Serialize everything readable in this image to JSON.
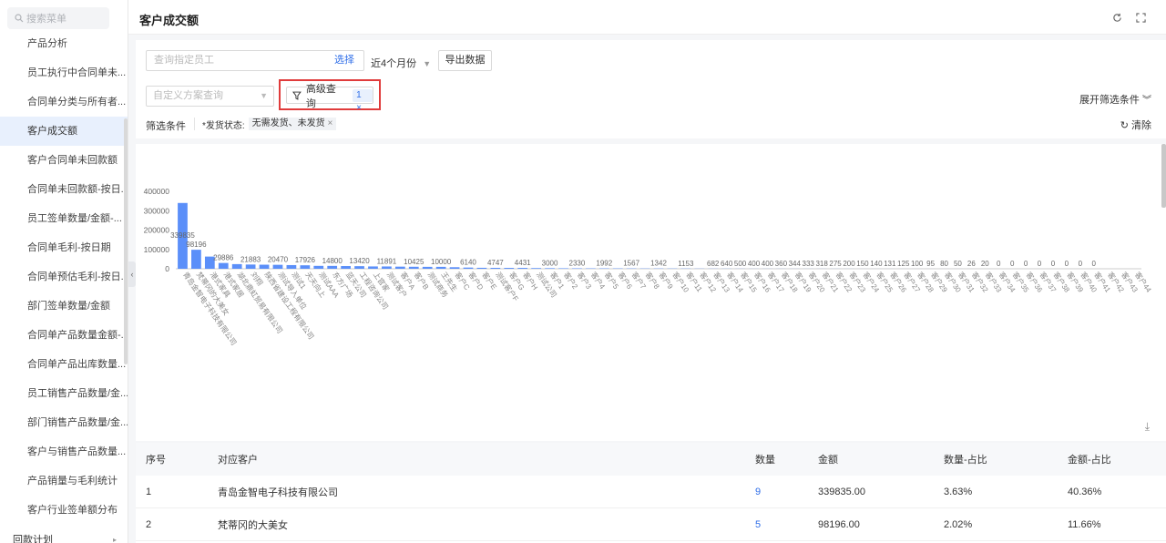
{
  "sidebar": {
    "search_placeholder": "搜索菜单",
    "items": [
      {
        "label": "产品分析"
      },
      {
        "label": "员工执行中合同单未..."
      },
      {
        "label": "合同单分类与所有者..."
      },
      {
        "label": "客户成交额"
      },
      {
        "label": "客户合同单未回款额"
      },
      {
        "label": "合同单未回款额-按日..."
      },
      {
        "label": "员工签单数量/金额-..."
      },
      {
        "label": "合同单毛利-按日期"
      },
      {
        "label": "合同单预估毛利-按日..."
      },
      {
        "label": "部门签单数量/金额"
      },
      {
        "label": "合同单产品数量金额-..."
      },
      {
        "label": "合同单产品出库数量..."
      },
      {
        "label": "员工销售产品数量/金..."
      },
      {
        "label": "部门销售产品数量/金..."
      },
      {
        "label": "客户与销售产品数量..."
      },
      {
        "label": "产品销量与毛利统计"
      },
      {
        "label": "客户行业签单额分布"
      }
    ],
    "group_label": "回款计划",
    "active_index": 3
  },
  "header": {
    "title": "客户成交额"
  },
  "filters": {
    "employee_placeholder": "查询指定员工",
    "employee_select": "选择",
    "period": "近4个月份",
    "export": "导出数据",
    "scheme_placeholder": "自定义方案查询",
    "advanced": "高级查询",
    "advanced_count": "1",
    "expand": "展开筛选条件",
    "condition_label": "筛选条件",
    "condition_key": "*发货状态:",
    "condition_value": "无需发货、未发货",
    "clear": "清除"
  },
  "chart_data": {
    "type": "bar",
    "color": "#5b8ff9",
    "ylim": [
      0,
      400000
    ],
    "yticks": [
      0,
      100000,
      200000,
      300000,
      400000
    ],
    "categories": [
      "青岛金智电子科技有限公司",
      "梵蒂冈的大美女",
      "港式家具",
      "港式家居",
      "湖北鼎虹贸易有限公司",
      "刘翔",
      "陕西省建设工程有限公司",
      "测试导入单位",
      "测试1",
      "天天向上",
      "测试AAA",
      "东方广场",
      "蓝天公司",
      "工程咨询公司",
      "上官家",
      "测试客户",
      "客户A",
      "客户B",
      "测试商务",
      "王先生",
      "客户C",
      "客户D",
      "客户E",
      "测试客户F",
      "客户G",
      "客户H",
      "测试公司",
      "客户1",
      "客户2",
      "客户3",
      "客户4",
      "客户5",
      "客户6",
      "客户7",
      "客户8",
      "客户9",
      "客户10",
      "客户11",
      "客户12",
      "客户13",
      "客户14",
      "客户15",
      "客户16",
      "客户17",
      "客户18",
      "客户19",
      "客户20",
      "客户21",
      "客户22",
      "客户23",
      "客户24",
      "客户25",
      "客户26",
      "客户27",
      "客户28",
      "客户29",
      "客户30",
      "客户31",
      "客户32",
      "客户33",
      "客户34",
      "客户35",
      "客户36",
      "客户37",
      "客户38",
      "客户39",
      "客户40",
      "客户41",
      "客户42",
      "客户43",
      "客户44"
    ],
    "values": [
      339835,
      98196,
      63000,
      29886,
      24000,
      21883,
      21000,
      20470,
      19000,
      17926,
      15000,
      14800,
      14000,
      13420,
      12000,
      11891,
      11000,
      10425,
      10000,
      10000,
      8000,
      6140,
      5000,
      4747,
      4500,
      4431,
      3500,
      3000,
      2500,
      2330,
      2000,
      1992,
      1800,
      1567,
      1400,
      1342,
      1200,
      1153,
      900,
      682,
      640,
      500,
      400,
      400,
      360,
      344,
      333,
      318,
      275,
      200,
      150,
      140,
      131,
      125,
      100,
      95,
      80,
      50,
      26,
      20,
      0,
      0,
      0,
      0,
      0,
      0,
      0,
      0,
      0,
      0,
      0
    ],
    "labels": [
      {
        "i": 0,
        "text": "339835"
      },
      {
        "i": 1,
        "text": "98196"
      },
      {
        "i": 3,
        "text": "29886"
      },
      {
        "i": 5,
        "text": "21883"
      },
      {
        "i": 7,
        "text": "20470"
      },
      {
        "i": 9,
        "text": "17926"
      },
      {
        "i": 11,
        "text": "14800"
      },
      {
        "i": 13,
        "text": "13420"
      },
      {
        "i": 15,
        "text": "11891"
      },
      {
        "i": 17,
        "text": "10425"
      },
      {
        "i": 19,
        "text": "10000"
      },
      {
        "i": 21,
        "text": "6140"
      },
      {
        "i": 23,
        "text": "4747"
      },
      {
        "i": 25,
        "text": "4431"
      },
      {
        "i": 27,
        "text": "3000"
      },
      {
        "i": 29,
        "text": "2330"
      },
      {
        "i": 31,
        "text": "1992"
      },
      {
        "i": 33,
        "text": "1567"
      },
      {
        "i": 35,
        "text": "1342"
      },
      {
        "i": 37,
        "text": "1153"
      },
      {
        "i": 39,
        "text": "682"
      },
      {
        "i": 40,
        "text": "640"
      },
      {
        "i": 41,
        "text": "500"
      },
      {
        "i": 42,
        "text": "400"
      },
      {
        "i": 43,
        "text": "400"
      },
      {
        "i": 44,
        "text": "360"
      },
      {
        "i": 45,
        "text": "344"
      },
      {
        "i": 46,
        "text": "333"
      },
      {
        "i": 47,
        "text": "318"
      },
      {
        "i": 48,
        "text": "275"
      },
      {
        "i": 49,
        "text": "200"
      },
      {
        "i": 50,
        "text": "150"
      },
      {
        "i": 51,
        "text": "140"
      },
      {
        "i": 52,
        "text": "131"
      },
      {
        "i": 53,
        "text": "125"
      },
      {
        "i": 54,
        "text": "100"
      },
      {
        "i": 55,
        "text": "95"
      },
      {
        "i": 56,
        "text": "80"
      },
      {
        "i": 57,
        "text": "50"
      },
      {
        "i": 58,
        "text": "26"
      },
      {
        "i": 59,
        "text": "20"
      },
      {
        "i": 60,
        "text": "0"
      },
      {
        "i": 61,
        "text": "0"
      },
      {
        "i": 62,
        "text": "0"
      },
      {
        "i": 63,
        "text": "0"
      },
      {
        "i": 64,
        "text": "0"
      },
      {
        "i": 65,
        "text": "0"
      },
      {
        "i": 66,
        "text": "0"
      },
      {
        "i": 67,
        "text": "0"
      }
    ]
  },
  "table": {
    "headers": [
      "序号",
      "对应客户",
      "数量",
      "金额",
      "数量-占比",
      "金额-占比"
    ],
    "rows": [
      {
        "index": "1",
        "customer": "青岛金智电子科技有限公司",
        "qty": "9",
        "amount": "339835.00",
        "qty_pct": "3.63%",
        "amount_pct": "40.36%"
      },
      {
        "index": "2",
        "customer": "梵蒂冈的大美女",
        "qty": "5",
        "amount": "98196.00",
        "qty_pct": "2.02%",
        "amount_pct": "11.66%"
      }
    ]
  }
}
